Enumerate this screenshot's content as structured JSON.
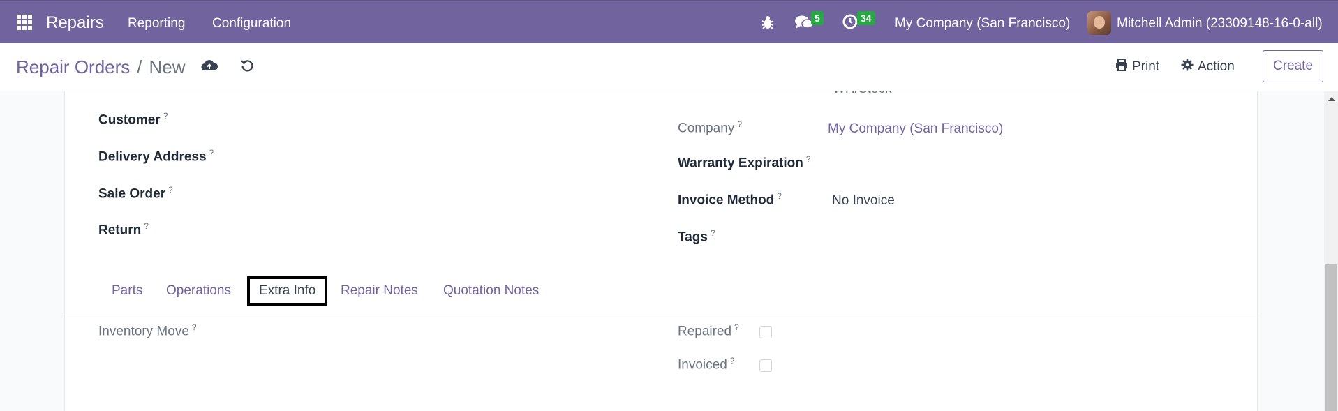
{
  "navbar": {
    "app_name": "Repairs",
    "menu": [
      "Reporting",
      "Configuration"
    ],
    "messages_count": "5",
    "activities_count": "34",
    "company": "My Company (San Francisco)",
    "user": "Mitchell Admin (23309148-16-0-all)"
  },
  "control_panel": {
    "breadcrumb_parent": "Repair Orders",
    "breadcrumb_sep": "/",
    "breadcrumb_current": "New",
    "print_label": "Print",
    "action_label": "Action",
    "create_label": "Create"
  },
  "form": {
    "location_value": "WH/Stock",
    "left_fields": [
      "Customer",
      "Delivery Address",
      "Sale Order",
      "Return"
    ],
    "right_fields": {
      "company_label": "Company",
      "company_value": "My Company (San Francisco)",
      "warranty_label": "Warranty Expiration",
      "invoice_method_label": "Invoice Method",
      "invoice_method_value": "No Invoice",
      "tags_label": "Tags"
    },
    "help_mark": "?"
  },
  "tabs": [
    "Parts",
    "Operations",
    "Extra Info",
    "Repair Notes",
    "Quotation Notes"
  ],
  "active_tab": "Extra Info",
  "extra_info": {
    "inventory_move_label": "Inventory Move",
    "repaired_label": "Repaired",
    "repaired_checked": false,
    "invoiced_label": "Invoiced",
    "invoiced_checked": false
  },
  "colors": {
    "brand": "#71639e",
    "badge": "#28a745"
  }
}
